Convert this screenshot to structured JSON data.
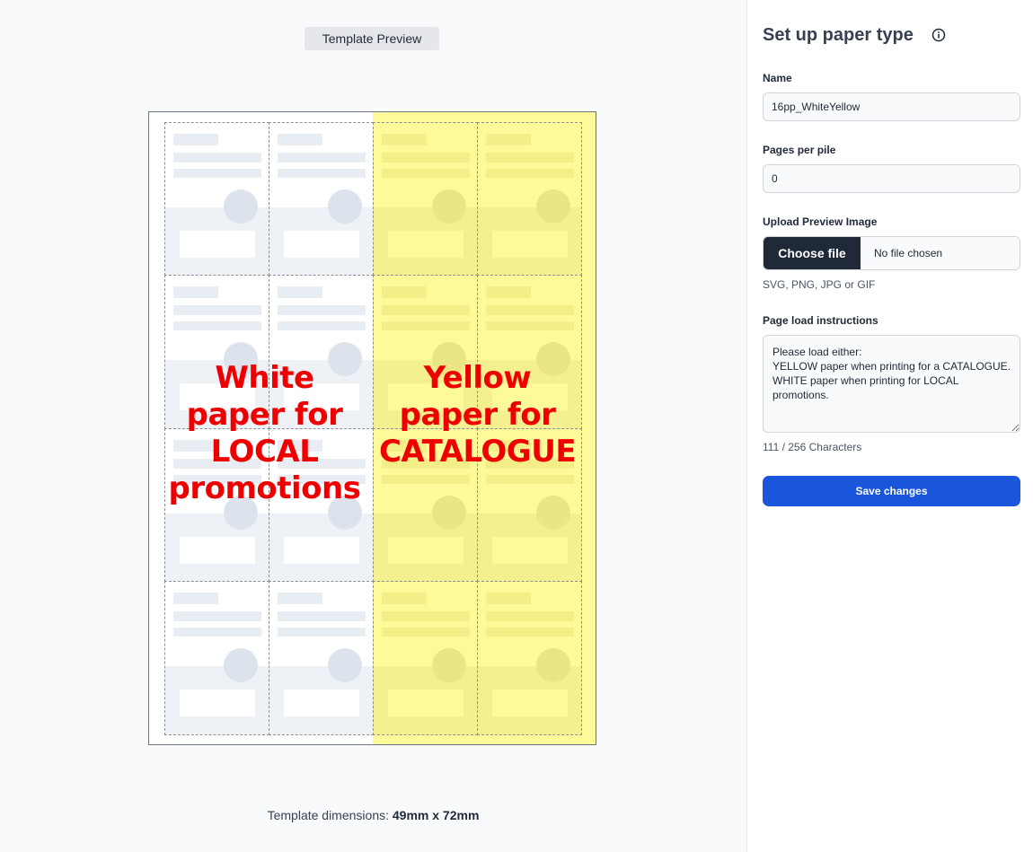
{
  "preview": {
    "button_label": "Template Preview",
    "overlay_white": "White paper for LOCAL promotions",
    "overlay_yellow": "Yellow paper for CATALOGUE",
    "dimensions_prefix": "Template dimensions:",
    "dimensions_value": "49mm x 72mm",
    "colors": {
      "white_paper": "#ffffff",
      "yellow_paper": "#fffa99",
      "overlay_text": "#ee0000"
    }
  },
  "settings": {
    "title": "Set up paper type",
    "title_icon": "info-icon",
    "name_label": "Name",
    "name_value": "16pp_WhiteYellow",
    "pages_label": "Pages per pile",
    "pages_value": "0",
    "upload_label": "Upload Preview Image",
    "choose_file_label": "Choose file",
    "file_status": "No file chosen",
    "file_hint": "SVG, PNG, JPG or GIF",
    "instructions_label": "Page load instructions",
    "instructions_value": "Please load either:\nYELLOW paper when printing for a CATALOGUE.\nWHITE paper when printing for LOCAL promotions.",
    "char_count": "111 / 256 Characters",
    "save_label": "Save changes",
    "accent_color": "#1a56db"
  }
}
